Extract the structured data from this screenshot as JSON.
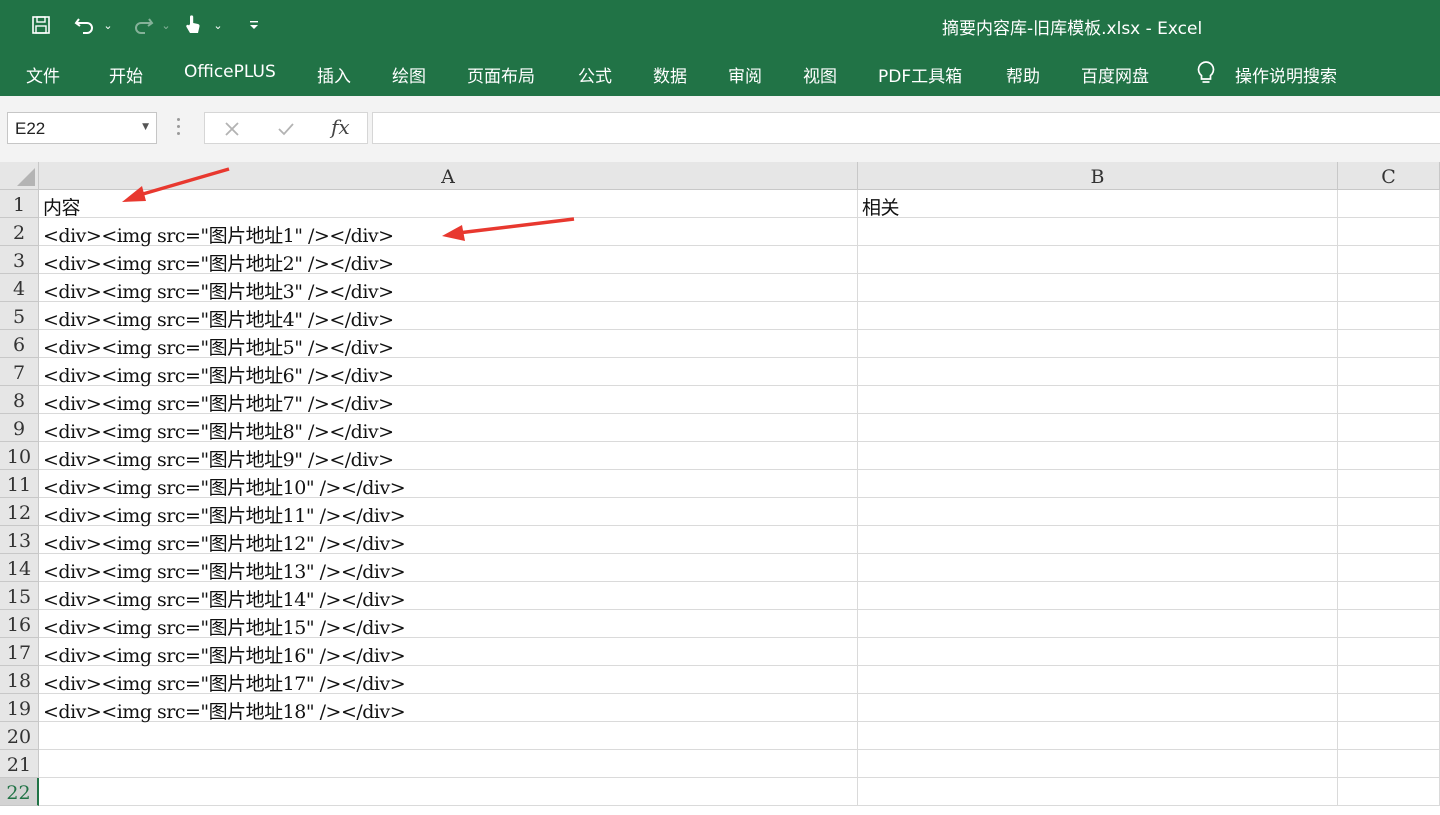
{
  "window": {
    "title": "摘要内容库-旧库模板.xlsx  -  Excel"
  },
  "quick_access": {
    "icons": [
      "save-icon",
      "undo-icon",
      "redo-icon",
      "touch-mode-icon",
      "customize-icon"
    ]
  },
  "ribbon": {
    "tabs": [
      "文件",
      "开始",
      "OfficePLUS",
      "插入",
      "绘图",
      "页面布局",
      "公式",
      "数据",
      "审阅",
      "视图",
      "PDF工具箱",
      "帮助",
      "百度网盘"
    ],
    "tell_me": "操作说明搜索"
  },
  "formula_bar": {
    "name_box": "E22",
    "fx": "fx",
    "formula": ""
  },
  "sheet": {
    "columns": [
      "A",
      "B",
      "C"
    ],
    "active_row": 22,
    "rows": [
      {
        "num": "1",
        "A": "内容",
        "B": "相关"
      },
      {
        "num": "2",
        "A": "<div><img src=\"图片地址1\" /></div>",
        "B": ""
      },
      {
        "num": "3",
        "A": "<div><img src=\"图片地址2\" /></div>",
        "B": ""
      },
      {
        "num": "4",
        "A": "<div><img src=\"图片地址3\" /></div>",
        "B": ""
      },
      {
        "num": "5",
        "A": "<div><img src=\"图片地址4\" /></div>",
        "B": ""
      },
      {
        "num": "6",
        "A": "<div><img src=\"图片地址5\" /></div>",
        "B": ""
      },
      {
        "num": "7",
        "A": "<div><img src=\"图片地址6\" /></div>",
        "B": ""
      },
      {
        "num": "8",
        "A": "<div><img src=\"图片地址7\" /></div>",
        "B": ""
      },
      {
        "num": "9",
        "A": "<div><img src=\"图片地址8\" /></div>",
        "B": ""
      },
      {
        "num": "10",
        "A": "<div><img src=\"图片地址9\" /></div>",
        "B": ""
      },
      {
        "num": "11",
        "A": "<div><img src=\"图片地址10\" /></div>",
        "B": ""
      },
      {
        "num": "12",
        "A": "<div><img src=\"图片地址11\" /></div>",
        "B": ""
      },
      {
        "num": "13",
        "A": "<div><img src=\"图片地址12\" /></div>",
        "B": ""
      },
      {
        "num": "14",
        "A": "<div><img src=\"图片地址13\" /></div>",
        "B": ""
      },
      {
        "num": "15",
        "A": "<div><img src=\"图片地址14\" /></div>",
        "B": ""
      },
      {
        "num": "16",
        "A": "<div><img src=\"图片地址15\" /></div>",
        "B": ""
      },
      {
        "num": "17",
        "A": "<div><img src=\"图片地址16\" /></div>",
        "B": ""
      },
      {
        "num": "18",
        "A": "<div><img src=\"图片地址17\" /></div>",
        "B": ""
      },
      {
        "num": "19",
        "A": "<div><img src=\"图片地址18\" /></div>",
        "B": ""
      },
      {
        "num": "20",
        "A": "",
        "B": ""
      },
      {
        "num": "21",
        "A": "",
        "B": ""
      },
      {
        "num": "22",
        "A": "",
        "B": ""
      }
    ]
  },
  "colors": {
    "ribbon_green": "#217346",
    "annotation_red": "#e8382f"
  }
}
